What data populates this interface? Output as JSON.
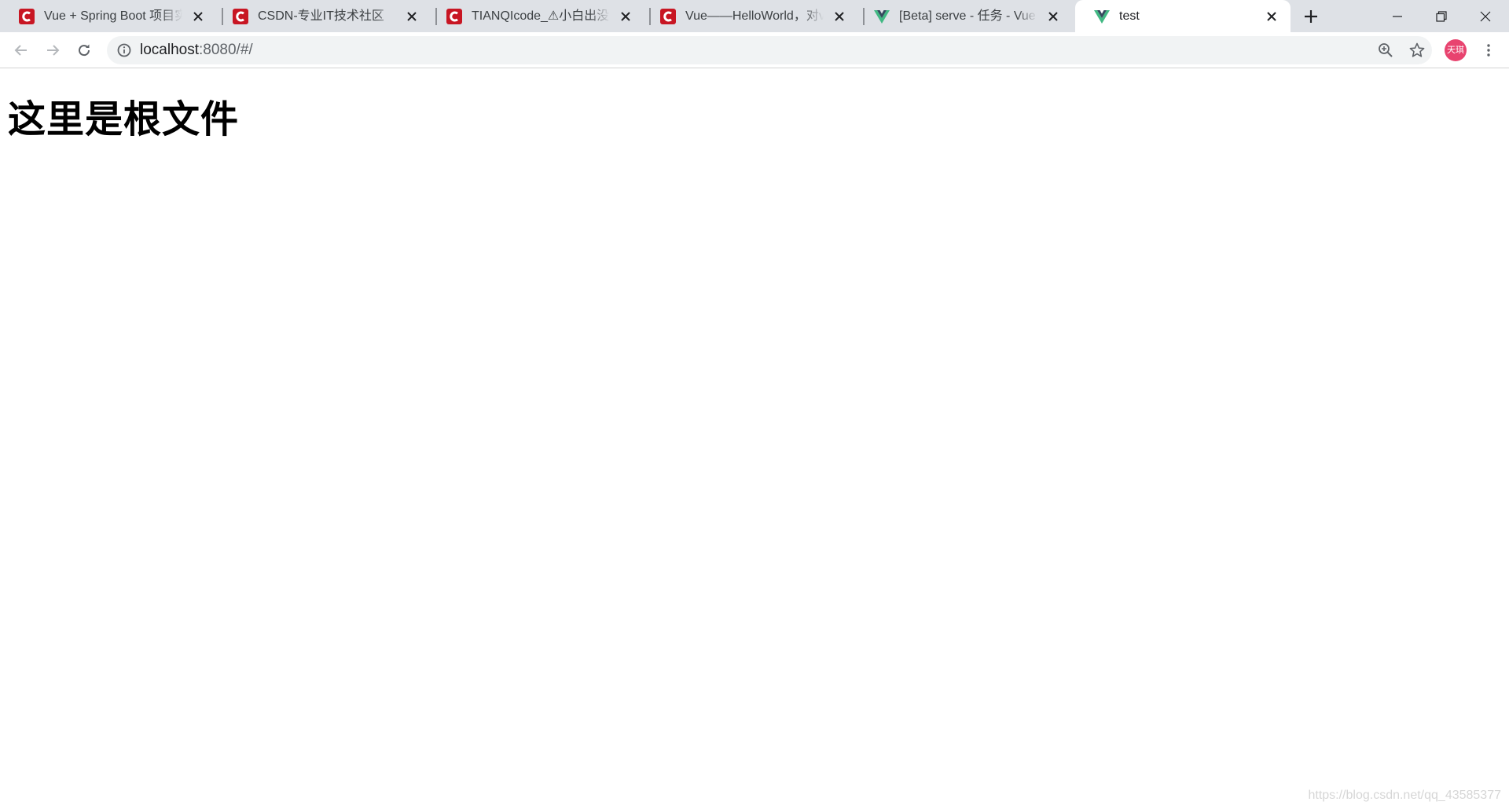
{
  "browser": {
    "tabs": [
      {
        "title": "Vue + Spring Boot 项目实战",
        "favicon": "csdn-icon",
        "active": false
      },
      {
        "title": "CSDN-专业IT技术社区",
        "favicon": "csdn-icon",
        "active": false
      },
      {
        "title": "TIANQIcode_⚠小白出没⚠",
        "favicon": "csdn-icon",
        "active": false
      },
      {
        "title": "Vue——HelloWorld，对vue",
        "favicon": "csdn-icon",
        "active": false
      },
      {
        "title": "[Beta] serve - 任务 - Vue CLI",
        "favicon": "vue-icon",
        "active": false
      },
      {
        "title": "test",
        "favicon": "vue-icon",
        "active": true
      }
    ],
    "address_bar": {
      "host": "localhost",
      "rest": ":8080/#/"
    },
    "profile_avatar": "天琪",
    "colors": {
      "tabstrip": "#dee1e6",
      "csdn_red": "#c81623",
      "vue_green": "#41b883",
      "vue_dark": "#35495e",
      "avatar": "#e8436f"
    }
  },
  "page": {
    "heading": "这里是根文件",
    "watermark": "https://blog.csdn.net/qq_43585377"
  }
}
